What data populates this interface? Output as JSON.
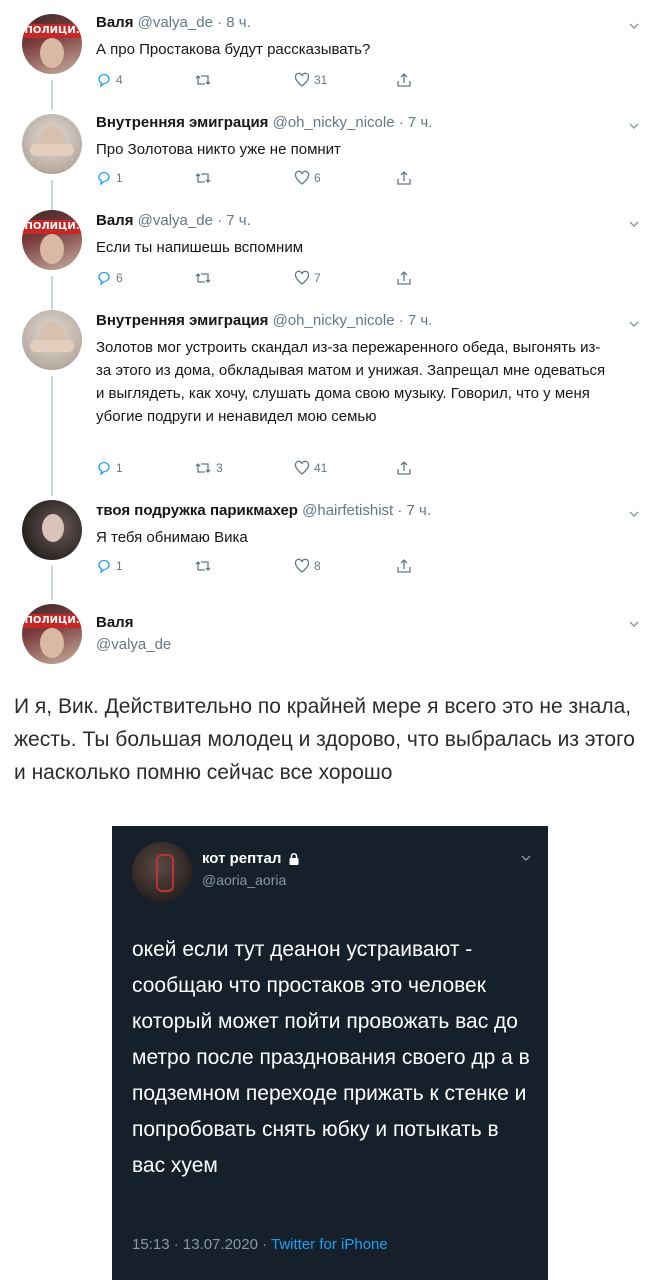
{
  "tweets": [
    {
      "name": "Валя",
      "handle": "@valya_de",
      "time": " · 8 ч.",
      "text": "А про Простакова будут рассказывать?",
      "replies": "4",
      "retweets": "",
      "likes": "31",
      "avatar_text": "ПОЛИЦИ."
    },
    {
      "name": "Внутренняя эмиграция",
      "handle": "@oh_nicky_nicole",
      "time": " · 7 ч.",
      "text": "Про Золотова никто уже не помнит",
      "replies": "1",
      "retweets": "",
      "likes": "6"
    },
    {
      "name": "Валя",
      "handle": "@valya_de",
      "time": " · 7 ч.",
      "text": "Если ты напишешь вспомним",
      "replies": "6",
      "retweets": "",
      "likes": "7",
      "avatar_text": "ПОЛИЦИ."
    },
    {
      "name": "Внутренняя эмиграция",
      "handle": "@oh_nicky_nicole",
      "time": " · 7 ч.",
      "text": "Золотов мог устроить скандал из-за пережаренного обеда, выгонять из-за этого из дома, обкладывая матом и унижая. Запрещал мне одеваться и выглядеть, как хочу, слушать дома свою музыку. Говорил, что у меня убогие подруги и ненавидел мою семью",
      "replies": "1",
      "retweets": "3",
      "likes": "41"
    },
    {
      "name": "твоя подружка парикмахер",
      "handle": "@hairfetishist",
      "time": " · 7 ч.",
      "text": "Я тебя обнимаю Вика",
      "replies": "1",
      "retweets": "",
      "likes": "8"
    }
  ],
  "focus_tweet": {
    "name": "Валя",
    "handle": "@valya_de",
    "avatar_text": "ПОЛИЦИ."
  },
  "comment": "И я, Вик. Действительно по крайней мере я всего это не знала, жесть. Ты большая молодец и здорово, что выбралась из этого и насколько помню сейчас все хорошо",
  "dark_tweet": {
    "name": "кот рептал",
    "handle": "@aoria_aoria",
    "text": "окей если тут деанон устраивают - сообщаю что простаков это человек который может пойти провожать вас до метро после празднования своего др а в подземном переходе прижать к стенке и попробовать снять юбку и потыкать в вас хуем",
    "time": "15:13 · 13.07.2020 · ",
    "source": "Twitter for iPhone"
  },
  "colors": {
    "text": "#14171a",
    "secondary": "#657786",
    "dark_bg": "#15202b",
    "link": "#1da1f2"
  }
}
